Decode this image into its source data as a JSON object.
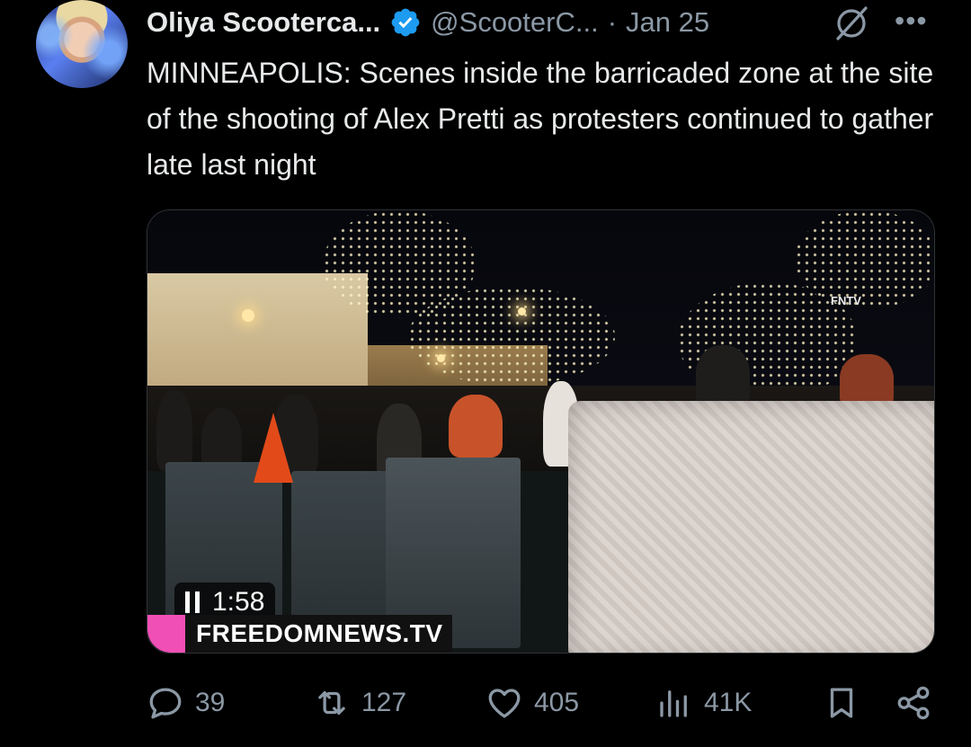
{
  "tweet": {
    "author_name": "Oliya Scooterca...",
    "handle": "@ScooterC...",
    "separator": "·",
    "date": "Jan 25",
    "more_label": "•••",
    "text": "MINNEAPOLIS: Scenes inside the barricaded zone at the site of the shooting of Alex Pretti as protesters continued to gather late last night"
  },
  "media": {
    "playback_time": "1:58",
    "watermark_brand": "FREEDOMNEWS.TV",
    "corner_logo": "FNTV"
  },
  "actions": {
    "replies": "39",
    "reposts": "127",
    "likes": "405",
    "views": "41K"
  },
  "icons": {
    "verified": "verified-badge-icon",
    "grok": "grok-icon",
    "more": "more-icon",
    "reply": "reply-icon",
    "repost": "repost-icon",
    "like": "heart-icon",
    "views": "views-icon",
    "bookmark": "bookmark-icon",
    "share": "share-icon"
  },
  "colors": {
    "background": "#000000",
    "text": "#e7e9ea",
    "secondary": "#8b98a5",
    "verified": "#1d9bf0",
    "brand_pink": "#f04fb5"
  }
}
